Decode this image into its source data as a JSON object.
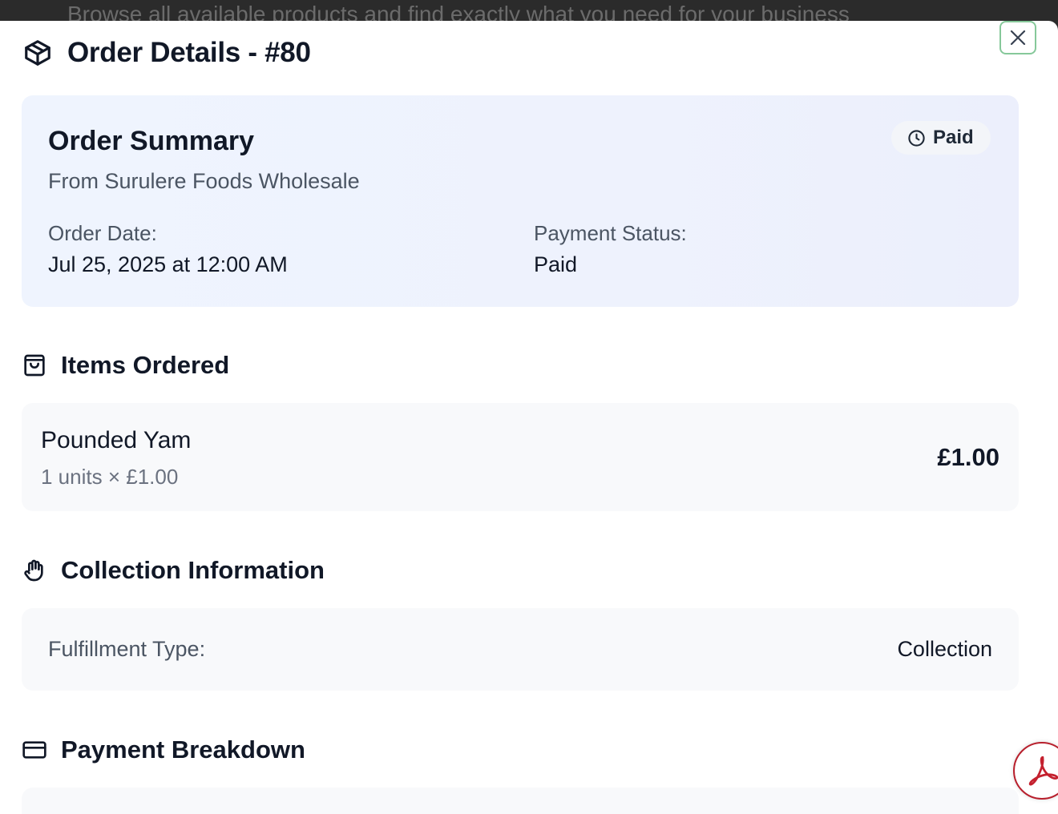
{
  "backdrop": {
    "text": "Browse all available products and find exactly what you need for your business"
  },
  "modal": {
    "title": "Order Details - #80",
    "close_label": "×"
  },
  "summary": {
    "title": "Order Summary",
    "from": "From Surulere Foods Wholesale",
    "status_badge": "Paid",
    "order_date_label": "Order Date:",
    "order_date_value": "Jul 25, 2025 at 12:00 AM",
    "payment_status_label": "Payment Status:",
    "payment_status_value": "Paid"
  },
  "items_section": {
    "title": "Items Ordered",
    "items": [
      {
        "name": "Pounded Yam",
        "qty": "1 units × £1.00",
        "price": "£1.00"
      }
    ]
  },
  "collection_section": {
    "title": "Collection Information",
    "fulfillment_label": "Fulfillment Type:",
    "fulfillment_value": "Collection"
  },
  "payment_section": {
    "title": "Payment Breakdown"
  },
  "colors": {
    "accent_green": "#86c89a",
    "summary_bg": "#eef2fd",
    "pdf_red": "#b8202d"
  },
  "icons": {
    "header": "package-icon",
    "status": "clock-icon",
    "items": "shopping-bag-icon",
    "collection": "hand-icon",
    "payment": "credit-card-icon",
    "floating": "pdf-icon"
  }
}
